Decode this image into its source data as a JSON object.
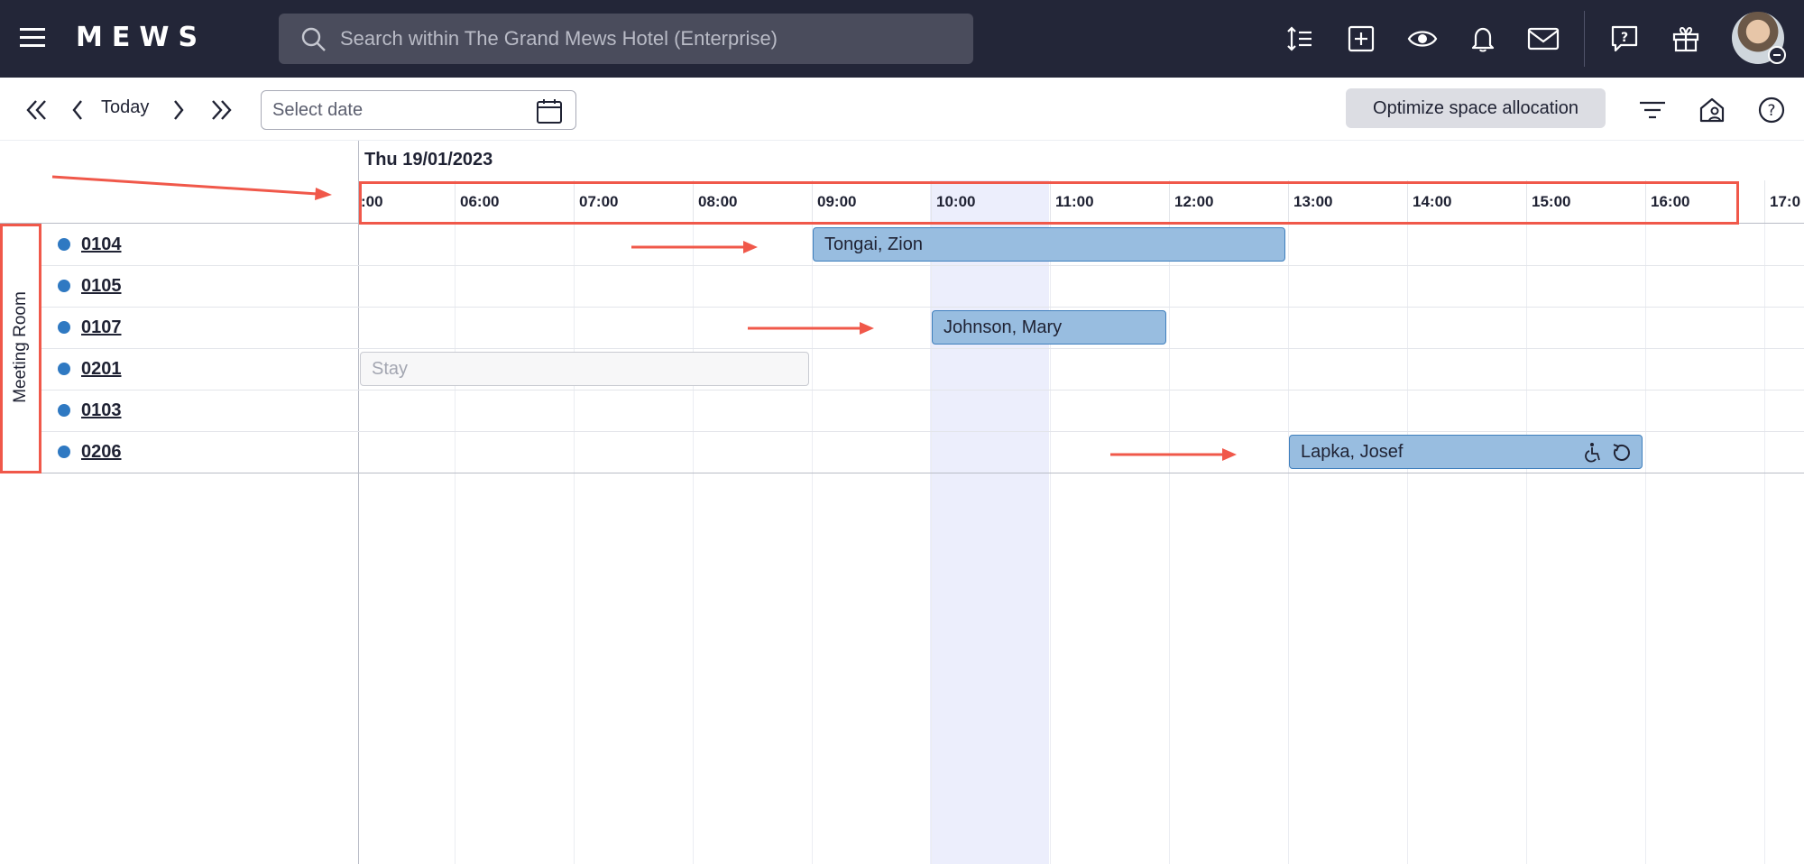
{
  "brand": {
    "logo": "MEWS"
  },
  "search": {
    "placeholder": "Search within The Grand Mews Hotel (Enterprise)"
  },
  "toolbar": {
    "today_label": "Today",
    "date_placeholder": "Select date",
    "optimize_label": "Optimize space allocation"
  },
  "timeline": {
    "date": "Thu 19/01/2023",
    "hours": [
      ":00",
      "06:00",
      "07:00",
      "08:00",
      "09:00",
      "10:00",
      "11:00",
      "12:00",
      "13:00",
      "14:00",
      "15:00",
      "16:00",
      "17:0"
    ]
  },
  "category": {
    "label": "Meeting Room"
  },
  "rooms": [
    {
      "number": "0104"
    },
    {
      "number": "0105"
    },
    {
      "number": "0107"
    },
    {
      "number": "0201"
    },
    {
      "number": "0103"
    },
    {
      "number": "0206"
    }
  ],
  "bookings": [
    {
      "guest": "Tongai, Zion",
      "room": "0104"
    },
    {
      "guest": "Johnson, Mary",
      "room": "0107"
    },
    {
      "guest": "Lapka, Josef",
      "room": "0206"
    }
  ],
  "stay": {
    "label": "Stay",
    "room": "0201"
  },
  "colors": {
    "nav_bg": "#232638",
    "booking_fill": "#98bde0",
    "booking_border": "#3f7fbd",
    "room_bullet": "#2f79c2",
    "current_hour_highlight": "#eceefc",
    "annotation": "#f0584a"
  },
  "icons": {
    "nav": [
      "menu-icon",
      "search-icon"
    ],
    "top_right": [
      "row-height-icon",
      "add-icon",
      "eye-icon",
      "bell-icon",
      "mail-icon",
      "help-chat-icon",
      "gift-icon"
    ],
    "toolbar": [
      "double-chevron-left-icon",
      "chevron-left-icon",
      "chevron-right-icon",
      "double-chevron-right-icon",
      "calendar-icon",
      "filter-icon",
      "home-user-icon",
      "help-icon"
    ],
    "booking": [
      "wheelchair-icon",
      "recurring-icon"
    ]
  }
}
